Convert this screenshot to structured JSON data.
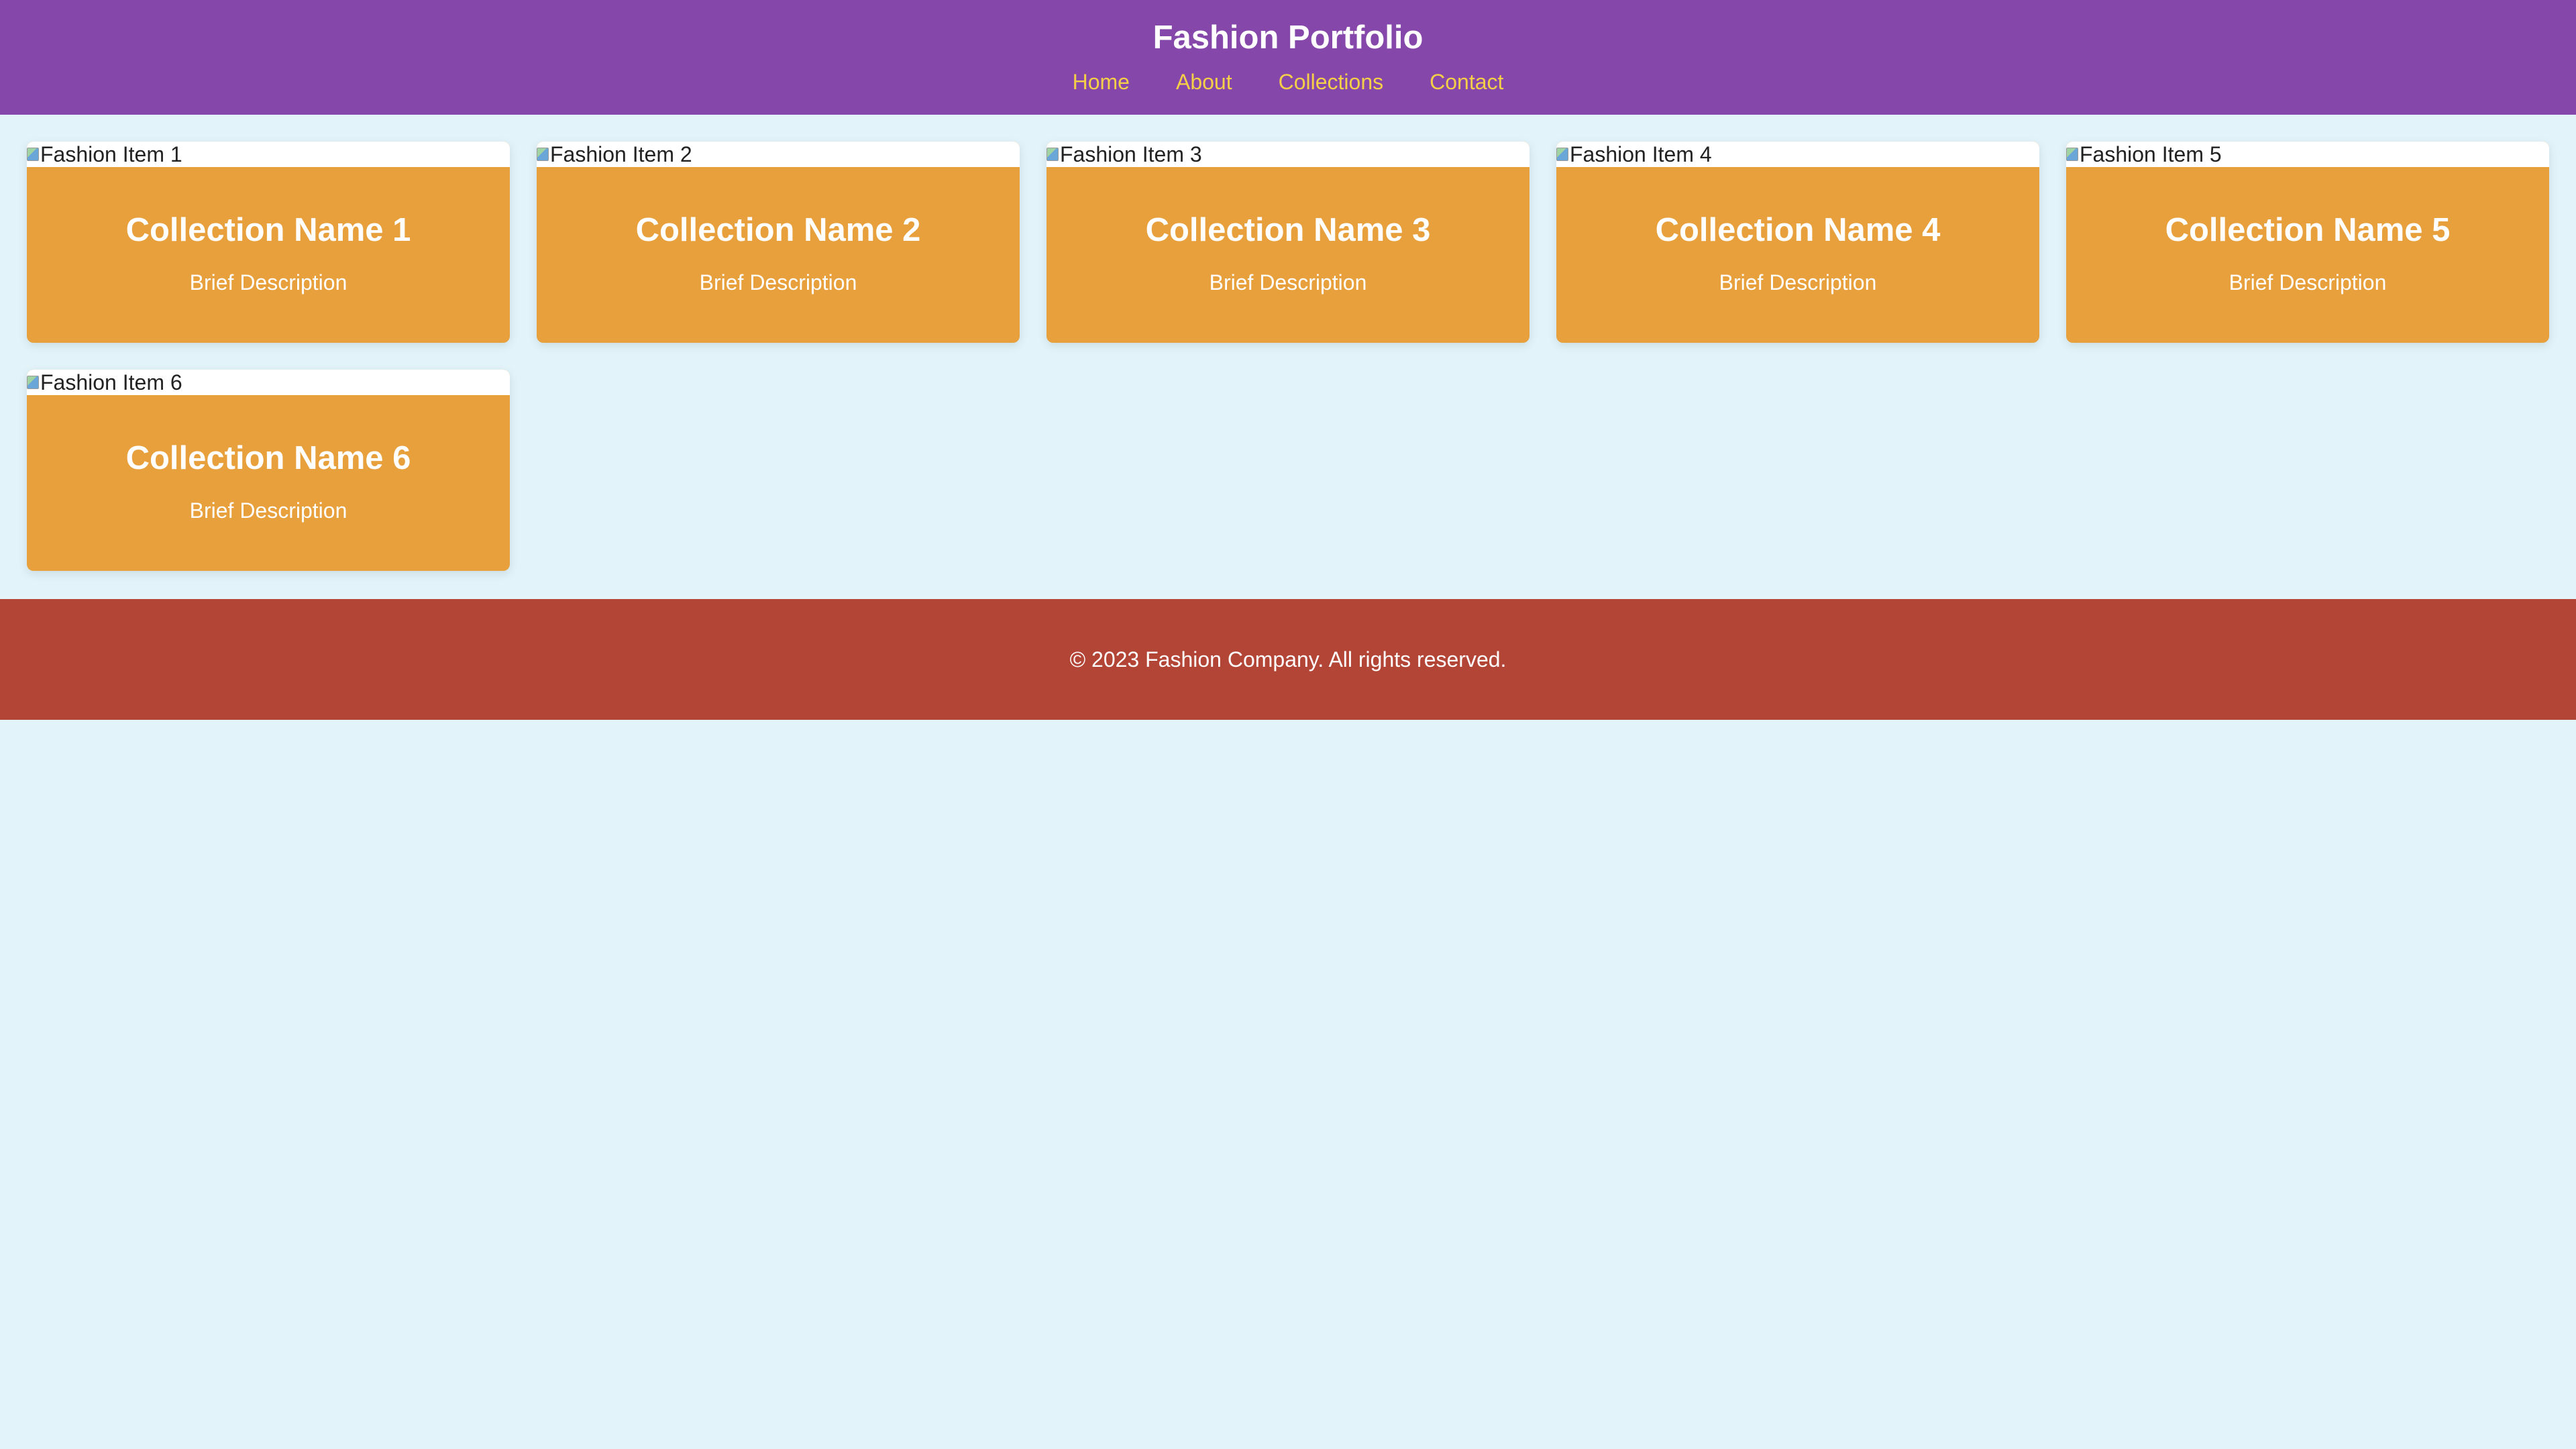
{
  "header": {
    "title": "Fashion Portfolio",
    "nav": [
      "Home",
      "About",
      "Collections",
      "Contact"
    ]
  },
  "gallery": {
    "items": [
      {
        "image_alt": "Fashion Item 1",
        "title": "Collection Name 1",
        "description": "Brief Description"
      },
      {
        "image_alt": "Fashion Item 2",
        "title": "Collection Name 2",
        "description": "Brief Description"
      },
      {
        "image_alt": "Fashion Item 3",
        "title": "Collection Name 3",
        "description": "Brief Description"
      },
      {
        "image_alt": "Fashion Item 4",
        "title": "Collection Name 4",
        "description": "Brief Description"
      },
      {
        "image_alt": "Fashion Item 5",
        "title": "Collection Name 5",
        "description": "Brief Description"
      },
      {
        "image_alt": "Fashion Item 6",
        "title": "Collection Name 6",
        "description": "Brief Description"
      }
    ]
  },
  "footer": {
    "copyright": "© 2023 Fashion Company. All rights reserved."
  },
  "colors": {
    "background": "#e2f4f9",
    "header": "#8548aa",
    "nav_link": "#f4cf47",
    "card": "#e8a03c",
    "footer": "#b34536"
  }
}
